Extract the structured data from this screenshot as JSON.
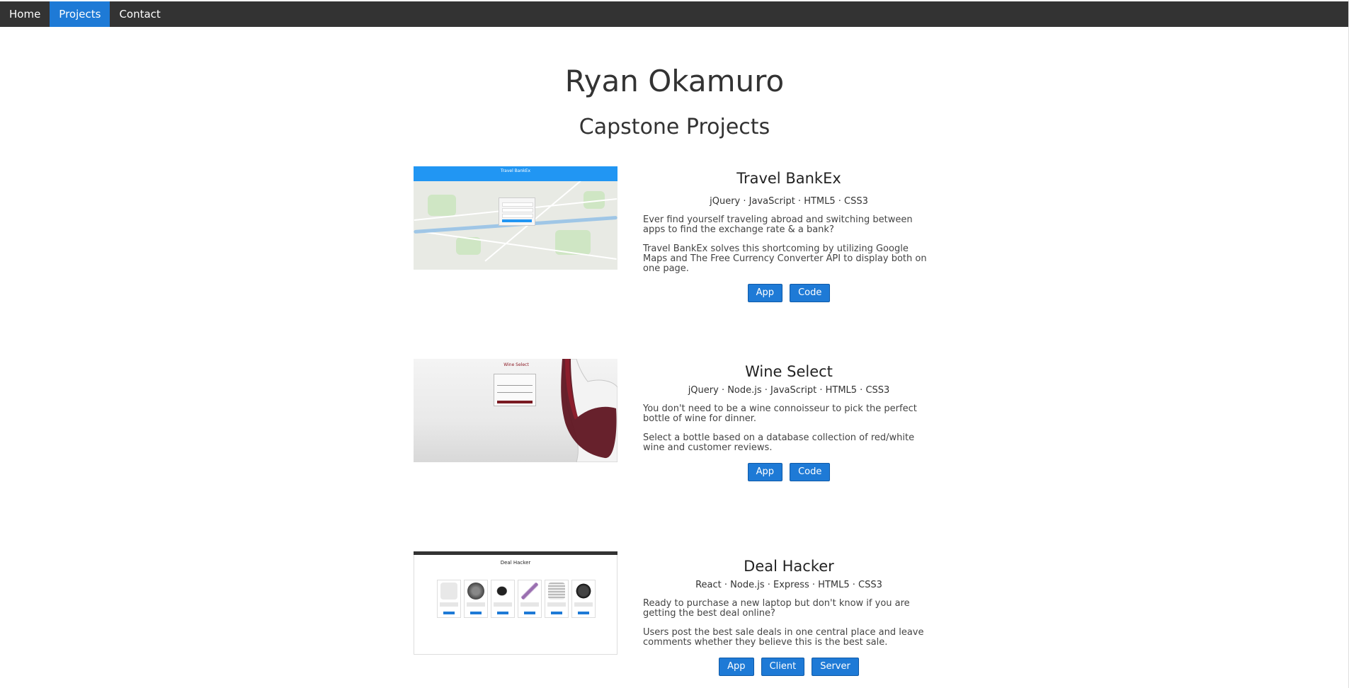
{
  "nav": {
    "items": [
      {
        "label": "Home",
        "active": false
      },
      {
        "label": "Projects",
        "active": true
      },
      {
        "label": "Contact",
        "active": false
      }
    ]
  },
  "header": {
    "name": "Ryan Okamuro",
    "section_title": "Capstone Projects"
  },
  "projects": [
    {
      "title": "Travel BankEx",
      "tech": "jQuery · JavaScript · HTML5 · CSS3",
      "desc1": "Ever find yourself traveling abroad and switching between apps to find the exchange rate & a bank?",
      "desc2": "Travel BankEx solves this shortcoming by utilizing Google Maps and The Free Currency Converter API to display both on one page.",
      "buttons": [
        "App",
        "Code"
      ],
      "thumb_title": "Travel BankEx"
    },
    {
      "title": "Wine Select",
      "tech": "jQuery · Node.js · JavaScript · HTML5 · CSS3",
      "desc1": "You don't need to be a wine connoisseur to pick the perfect bottle of wine for dinner.",
      "desc2": "Select a bottle based on a database collection of red/white wine and customer reviews.",
      "buttons": [
        "App",
        "Code"
      ],
      "thumb_title": "Wine Select"
    },
    {
      "title": "Deal Hacker",
      "tech": "React · Node.js · Express · HTML5 · CSS3",
      "desc1": "Ready to purchase a new laptop but don't know if you are getting the best deal online?",
      "desc2": "Users post the best sale deals in one central place and leave comments whether they believe this is the best sale.",
      "buttons": [
        "App",
        "Client",
        "Server"
      ],
      "thumb_title": "Deal Hacker"
    }
  ],
  "colors": {
    "nav_bg": "#333333",
    "accent": "#1e7ad6",
    "text": "#333333"
  }
}
